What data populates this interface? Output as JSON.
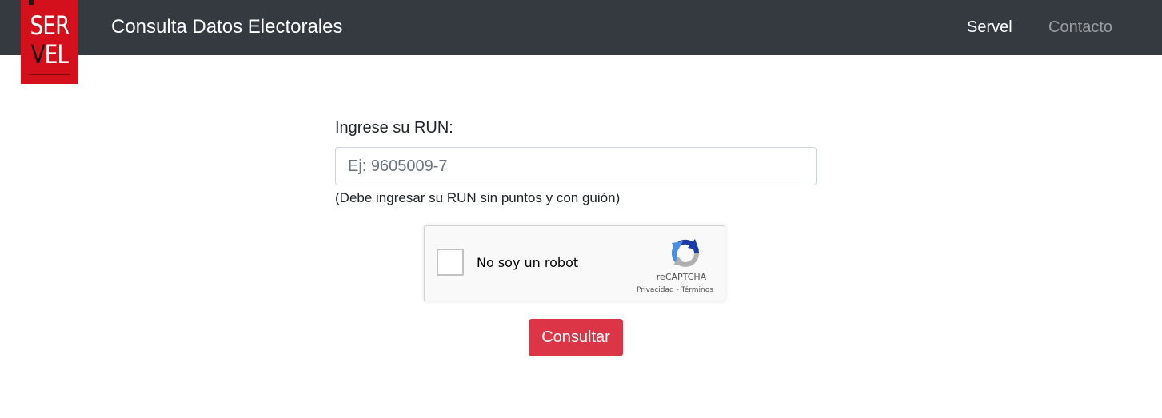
{
  "header": {
    "logo": {
      "line1": "SER",
      "line2_v": "V",
      "line2_rest": "EL"
    },
    "title": "Consulta Datos Electorales",
    "nav": [
      {
        "label": "Servel"
      },
      {
        "label": "Contacto"
      }
    ]
  },
  "form": {
    "run_label": "Ingrese su RUN:",
    "run_value": "",
    "run_placeholder": "Ej: 9605009-7",
    "run_help": "(Debe ingresar su RUN sin puntos y con guión)",
    "submit_label": "Consultar"
  },
  "recaptcha": {
    "checkbox_label": "No soy un robot",
    "brand": "reCAPTCHA",
    "privacy_label": "Privacidad",
    "separator": " - ",
    "terms_label": "Términos",
    "checked": false
  },
  "colors": {
    "navbar": "#343a40",
    "logo_red": "#d3101b",
    "button_red": "#dc3545",
    "nav_muted": "#9a9da0"
  },
  "icons": {
    "recaptcha_logo": "recaptcha-logo-icon",
    "checkbox": "checkbox-icon"
  }
}
